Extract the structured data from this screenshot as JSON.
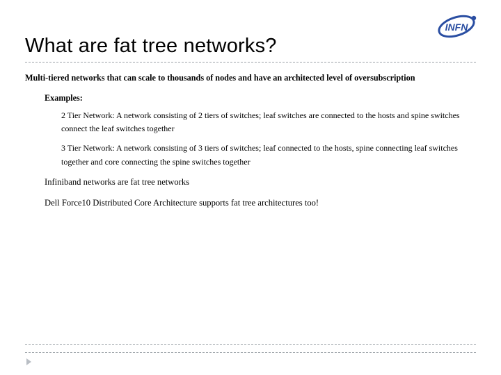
{
  "logo": {
    "name": "INFN",
    "ring_color": "#2a4ea2",
    "text_color": "#2a4ea2"
  },
  "title": "What are fat tree networks?",
  "intro": "Multi-tiered networks that can scale to thousands of nodes and have an architected level of oversubscription",
  "examples_label": "Examples:",
  "tiers": [
    "2 Tier Network: A network consisting of 2 tiers of switches; leaf switches are connected to the hosts and spine switches connect the leaf switches together",
    "3 Tier Network: A network consisting of 3 tiers of switches; leaf connected to the hosts, spine connecting leaf switches together and core connecting the spine switches together"
  ],
  "notes": [
    "Infiniband networks are fat tree networks",
    "Dell Force10 Distributed Core Architecture supports fat tree architectures too!"
  ]
}
